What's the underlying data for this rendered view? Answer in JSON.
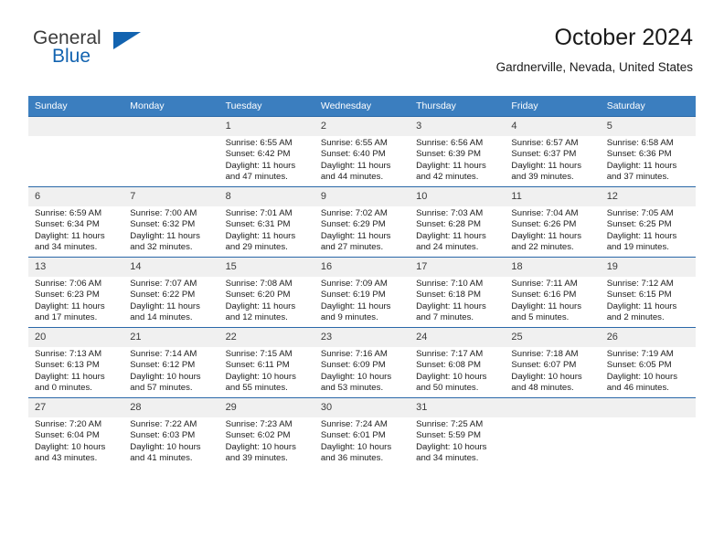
{
  "brand": {
    "word1": "General",
    "word2": "Blue",
    "triangle_icon": "brand-triangle-icon",
    "accent_color": "#1263b0"
  },
  "header": {
    "title": "October 2024",
    "location": "Gardnerville, Nevada, United States"
  },
  "theme": {
    "header_bg": "#3b7ebf",
    "row_rule": "#2a68a8",
    "daynum_bg": "#f0f0f0"
  },
  "weekday_headers": [
    "Sunday",
    "Monday",
    "Tuesday",
    "Wednesday",
    "Thursday",
    "Friday",
    "Saturday"
  ],
  "labels": {
    "sunrise": "Sunrise:",
    "sunset": "Sunset:",
    "daylight": "Daylight:"
  },
  "weeks": [
    [
      {
        "day": "",
        "empty": true
      },
      {
        "day": "",
        "empty": true
      },
      {
        "day": "1",
        "sunrise": "Sunrise: 6:55 AM",
        "sunset": "Sunset: 6:42 PM",
        "daylight1": "Daylight: 11 hours",
        "daylight2": "and 47 minutes."
      },
      {
        "day": "2",
        "sunrise": "Sunrise: 6:55 AM",
        "sunset": "Sunset: 6:40 PM",
        "daylight1": "Daylight: 11 hours",
        "daylight2": "and 44 minutes."
      },
      {
        "day": "3",
        "sunrise": "Sunrise: 6:56 AM",
        "sunset": "Sunset: 6:39 PM",
        "daylight1": "Daylight: 11 hours",
        "daylight2": "and 42 minutes."
      },
      {
        "day": "4",
        "sunrise": "Sunrise: 6:57 AM",
        "sunset": "Sunset: 6:37 PM",
        "daylight1": "Daylight: 11 hours",
        "daylight2": "and 39 minutes."
      },
      {
        "day": "5",
        "sunrise": "Sunrise: 6:58 AM",
        "sunset": "Sunset: 6:36 PM",
        "daylight1": "Daylight: 11 hours",
        "daylight2": "and 37 minutes."
      }
    ],
    [
      {
        "day": "6",
        "sunrise": "Sunrise: 6:59 AM",
        "sunset": "Sunset: 6:34 PM",
        "daylight1": "Daylight: 11 hours",
        "daylight2": "and 34 minutes."
      },
      {
        "day": "7",
        "sunrise": "Sunrise: 7:00 AM",
        "sunset": "Sunset: 6:32 PM",
        "daylight1": "Daylight: 11 hours",
        "daylight2": "and 32 minutes."
      },
      {
        "day": "8",
        "sunrise": "Sunrise: 7:01 AM",
        "sunset": "Sunset: 6:31 PM",
        "daylight1": "Daylight: 11 hours",
        "daylight2": "and 29 minutes."
      },
      {
        "day": "9",
        "sunrise": "Sunrise: 7:02 AM",
        "sunset": "Sunset: 6:29 PM",
        "daylight1": "Daylight: 11 hours",
        "daylight2": "and 27 minutes."
      },
      {
        "day": "10",
        "sunrise": "Sunrise: 7:03 AM",
        "sunset": "Sunset: 6:28 PM",
        "daylight1": "Daylight: 11 hours",
        "daylight2": "and 24 minutes."
      },
      {
        "day": "11",
        "sunrise": "Sunrise: 7:04 AM",
        "sunset": "Sunset: 6:26 PM",
        "daylight1": "Daylight: 11 hours",
        "daylight2": "and 22 minutes."
      },
      {
        "day": "12",
        "sunrise": "Sunrise: 7:05 AM",
        "sunset": "Sunset: 6:25 PM",
        "daylight1": "Daylight: 11 hours",
        "daylight2": "and 19 minutes."
      }
    ],
    [
      {
        "day": "13",
        "sunrise": "Sunrise: 7:06 AM",
        "sunset": "Sunset: 6:23 PM",
        "daylight1": "Daylight: 11 hours",
        "daylight2": "and 17 minutes."
      },
      {
        "day": "14",
        "sunrise": "Sunrise: 7:07 AM",
        "sunset": "Sunset: 6:22 PM",
        "daylight1": "Daylight: 11 hours",
        "daylight2": "and 14 minutes."
      },
      {
        "day": "15",
        "sunrise": "Sunrise: 7:08 AM",
        "sunset": "Sunset: 6:20 PM",
        "daylight1": "Daylight: 11 hours",
        "daylight2": "and 12 minutes."
      },
      {
        "day": "16",
        "sunrise": "Sunrise: 7:09 AM",
        "sunset": "Sunset: 6:19 PM",
        "daylight1": "Daylight: 11 hours",
        "daylight2": "and 9 minutes."
      },
      {
        "day": "17",
        "sunrise": "Sunrise: 7:10 AM",
        "sunset": "Sunset: 6:18 PM",
        "daylight1": "Daylight: 11 hours",
        "daylight2": "and 7 minutes."
      },
      {
        "day": "18",
        "sunrise": "Sunrise: 7:11 AM",
        "sunset": "Sunset: 6:16 PM",
        "daylight1": "Daylight: 11 hours",
        "daylight2": "and 5 minutes."
      },
      {
        "day": "19",
        "sunrise": "Sunrise: 7:12 AM",
        "sunset": "Sunset: 6:15 PM",
        "daylight1": "Daylight: 11 hours",
        "daylight2": "and 2 minutes."
      }
    ],
    [
      {
        "day": "20",
        "sunrise": "Sunrise: 7:13 AM",
        "sunset": "Sunset: 6:13 PM",
        "daylight1": "Daylight: 11 hours",
        "daylight2": "and 0 minutes."
      },
      {
        "day": "21",
        "sunrise": "Sunrise: 7:14 AM",
        "sunset": "Sunset: 6:12 PM",
        "daylight1": "Daylight: 10 hours",
        "daylight2": "and 57 minutes."
      },
      {
        "day": "22",
        "sunrise": "Sunrise: 7:15 AM",
        "sunset": "Sunset: 6:11 PM",
        "daylight1": "Daylight: 10 hours",
        "daylight2": "and 55 minutes."
      },
      {
        "day": "23",
        "sunrise": "Sunrise: 7:16 AM",
        "sunset": "Sunset: 6:09 PM",
        "daylight1": "Daylight: 10 hours",
        "daylight2": "and 53 minutes."
      },
      {
        "day": "24",
        "sunrise": "Sunrise: 7:17 AM",
        "sunset": "Sunset: 6:08 PM",
        "daylight1": "Daylight: 10 hours",
        "daylight2": "and 50 minutes."
      },
      {
        "day": "25",
        "sunrise": "Sunrise: 7:18 AM",
        "sunset": "Sunset: 6:07 PM",
        "daylight1": "Daylight: 10 hours",
        "daylight2": "and 48 minutes."
      },
      {
        "day": "26",
        "sunrise": "Sunrise: 7:19 AM",
        "sunset": "Sunset: 6:05 PM",
        "daylight1": "Daylight: 10 hours",
        "daylight2": "and 46 minutes."
      }
    ],
    [
      {
        "day": "27",
        "sunrise": "Sunrise: 7:20 AM",
        "sunset": "Sunset: 6:04 PM",
        "daylight1": "Daylight: 10 hours",
        "daylight2": "and 43 minutes."
      },
      {
        "day": "28",
        "sunrise": "Sunrise: 7:22 AM",
        "sunset": "Sunset: 6:03 PM",
        "daylight1": "Daylight: 10 hours",
        "daylight2": "and 41 minutes."
      },
      {
        "day": "29",
        "sunrise": "Sunrise: 7:23 AM",
        "sunset": "Sunset: 6:02 PM",
        "daylight1": "Daylight: 10 hours",
        "daylight2": "and 39 minutes."
      },
      {
        "day": "30",
        "sunrise": "Sunrise: 7:24 AM",
        "sunset": "Sunset: 6:01 PM",
        "daylight1": "Daylight: 10 hours",
        "daylight2": "and 36 minutes."
      },
      {
        "day": "31",
        "sunrise": "Sunrise: 7:25 AM",
        "sunset": "Sunset: 5:59 PM",
        "daylight1": "Daylight: 10 hours",
        "daylight2": "and 34 minutes."
      },
      {
        "day": "",
        "empty": true
      },
      {
        "day": "",
        "empty": true
      }
    ]
  ]
}
